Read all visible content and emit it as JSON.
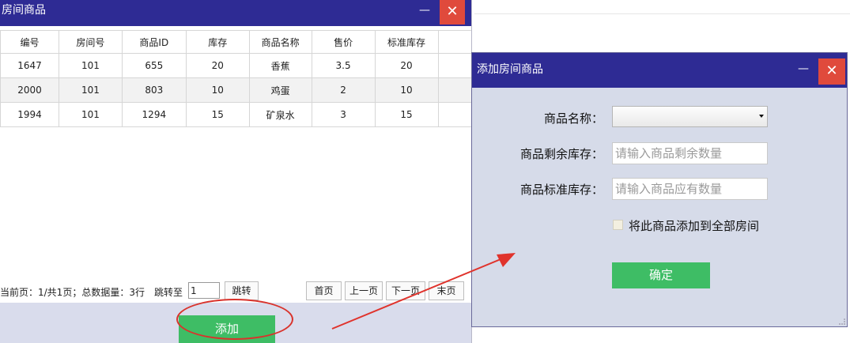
{
  "main_window": {
    "title": "房间商品",
    "minimize_glyph": "—",
    "close_glyph": "✕",
    "columns": [
      "编号",
      "房间号",
      "商品ID",
      "库存",
      "商品名称",
      "售价",
      "标准库存"
    ],
    "rows": [
      [
        "1647",
        "101",
        "655",
        "20",
        "香蕉",
        "3.5",
        "20"
      ],
      [
        "2000",
        "101",
        "803",
        "10",
        "鸡蛋",
        "2",
        "10"
      ],
      [
        "1994",
        "101",
        "1294",
        "15",
        "矿泉水",
        "3",
        "15"
      ]
    ],
    "pager": {
      "info": "当前页：1/共1页；总数据量：3行",
      "jump_label": "跳转至",
      "jump_value": "1",
      "jump_button": "跳转",
      "first": "首页",
      "prev": "上一页",
      "next": "下一页",
      "last": "末页"
    },
    "add_button": "添加"
  },
  "dialog": {
    "title": "添加房间商品",
    "minimize_glyph": "—",
    "close_glyph": "✕",
    "name_label": "商品名称：",
    "name_value": "",
    "remaining_label": "商品剩余库存：",
    "remaining_placeholder": "请输入商品剩余数量",
    "standard_label": "商品标准库存：",
    "standard_placeholder": "请输入商品应有数量",
    "all_rooms_checked": false,
    "all_rooms_label": "将此商品添加到全部房间",
    "confirm_button": "确定"
  },
  "colors": {
    "titlebar": "#2e2b94",
    "close": "#e04a3c",
    "button_green": "#3ebd65",
    "dialog_bg": "#d6dbe9",
    "annotation_red": "#d9332c"
  }
}
